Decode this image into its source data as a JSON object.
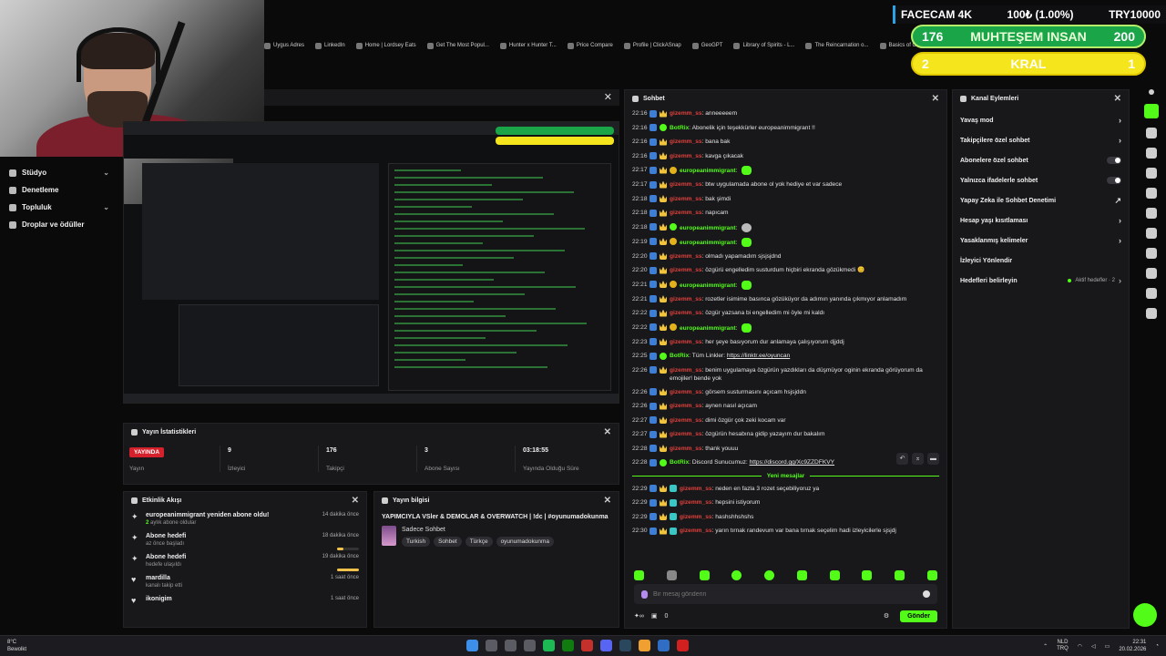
{
  "bookmarks": [
    "Uygus Adres",
    "LinkedIn",
    "Home | Lordsey Eats",
    "Get The Most Popul...",
    "Hunter x Hunter T...",
    "Price Compare",
    "Profile | ClickASnap",
    "GeoGPT",
    "Library of Spirits - L...",
    "The Reincarnation o...",
    "Basics of Online M..."
  ],
  "overlay": {
    "title": "FACECAM 4K",
    "progress": "100₺ (1.00%)",
    "goal_currency": "TRY10000",
    "goal1_left": "176",
    "goal1_label": "MUHTEŞEM INSAN",
    "goal1_right": "200",
    "goal2_left": "2",
    "goal2_label": "KRAL",
    "goal2_right": "1"
  },
  "sidebar": {
    "items": [
      {
        "label": "Stüdyo",
        "icon": "studio-icon",
        "expandable": true
      },
      {
        "label": "Denetleme",
        "icon": "moderation-icon",
        "expandable": false
      },
      {
        "label": "Topluluk",
        "icon": "community-icon",
        "expandable": true
      },
      {
        "label": "Droplar ve ödüller",
        "icon": "gift-icon",
        "expandable": false
      }
    ]
  },
  "stats": {
    "title": "Yayın İstatistikleri",
    "live_badge": "YAYINDA",
    "items": [
      {
        "value": "",
        "label": "Yayın"
      },
      {
        "value": "9",
        "label": "İzleyici"
      },
      {
        "value": "176",
        "label": "Takipçi"
      },
      {
        "value": "3",
        "label": "Abone Sayısı"
      },
      {
        "value": "03:18:55",
        "label": "Yayında Olduğu Süre"
      }
    ]
  },
  "activity": {
    "title": "Etkinlik Akışı",
    "items": [
      {
        "icon": "sparkle-icon",
        "title": "europeanimmigrant yeniden abone oldu!",
        "sub_strong": "2",
        "sub": "aylık abone oldular",
        "time": "14 dakika önce",
        "progress": null
      },
      {
        "icon": "sparkle-icon",
        "title": "Abone hedefi",
        "sub_strong": "",
        "sub": "az önce başladı",
        "time": "18 dakika önce",
        "progress": 0.3
      },
      {
        "icon": "sparkle-icon",
        "title": "Abone hedefi",
        "sub_strong": "",
        "sub": "hedefe ulaşıldı",
        "time": "19 dakika önce",
        "progress": 1.0
      },
      {
        "icon": "heart-icon",
        "title": "mardilla",
        "sub_strong": "",
        "sub": "kanalı takip etti",
        "time": "1 saat önce",
        "progress": null
      },
      {
        "icon": "heart-icon",
        "title": "ikonigim",
        "sub_strong": "",
        "sub": "",
        "time": "1 saat önce",
        "progress": null
      }
    ]
  },
  "stream_info": {
    "title": "Yayın bilgisi",
    "stream_title": "YAPIMCIYLA VSler & DEMOLAR & OVERWATCH | !dc | #oyunumadokunma",
    "category": "Sadece Sohbet",
    "tags": [
      "Turkish",
      "Sohbet",
      "Türkçe",
      "oyunumadokunma"
    ]
  },
  "chat": {
    "title": "Sohbet",
    "new_messages_label": "Yeni mesajlar",
    "input_placeholder": "Bir mesaj gönderin",
    "send_label": "Gönder",
    "footer_count": "0",
    "messages": [
      {
        "time": "22:16",
        "badges": [
          "blue",
          "crown"
        ],
        "user": "gizemm_ss",
        "uc": "u-red",
        "text": "anneeeeem"
      },
      {
        "time": "22:16",
        "badges": [
          "blue",
          "green"
        ],
        "user": "BotRix",
        "uc": "u-bot",
        "text": "Abonelik için teşekkürler europeanimmigrant !!"
      },
      {
        "time": "22:16",
        "badges": [
          "blue",
          "crown"
        ],
        "user": "gizemm_ss",
        "uc": "u-red",
        "text": "bana bak"
      },
      {
        "time": "22:16",
        "badges": [
          "blue",
          "crown"
        ],
        "user": "gizemm_ss",
        "uc": "u-red",
        "text": "kavga çıkacak"
      },
      {
        "time": "22:17",
        "badges": [
          "blue",
          "crown",
          "gold"
        ],
        "user": "europeanimmigrant",
        "uc": "u-green",
        "text": "",
        "emote": "green"
      },
      {
        "time": "22:17",
        "badges": [
          "blue",
          "crown"
        ],
        "user": "gizemm_ss",
        "uc": "u-red",
        "text": "btw uygulamada abone ol yok hediye et var sadece"
      },
      {
        "time": "22:18",
        "badges": [
          "blue",
          "crown"
        ],
        "user": "gizemm_ss",
        "uc": "u-red",
        "text": "bak şimdi"
      },
      {
        "time": "22:18",
        "badges": [
          "blue",
          "crown"
        ],
        "user": "gizemm_ss",
        "uc": "u-red",
        "text": "napıcam"
      },
      {
        "time": "22:18",
        "badges": [
          "blue",
          "crown",
          "green"
        ],
        "user": "europeanimmigrant",
        "uc": "u-green",
        "text": "",
        "emote": "gray"
      },
      {
        "time": "22:19",
        "badges": [
          "blue",
          "crown",
          "gold"
        ],
        "user": "europeanimmigrant",
        "uc": "u-green",
        "text": "",
        "emote": "green"
      },
      {
        "time": "22:20",
        "badges": [
          "blue",
          "crown"
        ],
        "user": "gizemm_ss",
        "uc": "u-red",
        "text": "olmadı yapamadım sjsjsjdnd"
      },
      {
        "time": "22:20",
        "badges": [
          "blue",
          "crown"
        ],
        "user": "gizemm_ss",
        "uc": "u-red",
        "text": "özgürü engelledim susturdum hiçbiri ekranda gözükmedi 😊"
      },
      {
        "time": "22:21",
        "badges": [
          "blue",
          "crown",
          "gold"
        ],
        "user": "europeanimmigrant",
        "uc": "u-green",
        "text": "",
        "emote": "green"
      },
      {
        "time": "22:21",
        "badges": [
          "blue",
          "crown"
        ],
        "user": "gizemm_ss",
        "uc": "u-red",
        "text": "rozetler isimime basınca gözüküyor da adımın yanında çıkmıyor anlamadım"
      },
      {
        "time": "22:22",
        "badges": [
          "blue",
          "crown"
        ],
        "user": "gizemm_ss",
        "uc": "u-red",
        "text": "özgür yazsana bi engelledim mi öyle mi kaldı"
      },
      {
        "time": "22:22",
        "badges": [
          "blue",
          "crown",
          "gold"
        ],
        "user": "europeanimmigrant",
        "uc": "u-green",
        "text": "",
        "emote": "green"
      },
      {
        "time": "22:23",
        "badges": [
          "blue",
          "crown"
        ],
        "user": "gizemm_ss",
        "uc": "u-red",
        "text": "her şeye basıyorum dur anlamaya çalışıyorum djjddj"
      },
      {
        "time": "22:25",
        "badges": [
          "blue",
          "green"
        ],
        "user": "BotRix",
        "uc": "u-bot",
        "text": "Tüm Linkler: ",
        "link": "https://linktr.ee/oyuncan"
      },
      {
        "time": "22:26",
        "badges": [
          "blue",
          "crown"
        ],
        "user": "gizemm_ss",
        "uc": "u-red",
        "text": "benim uygulamaya özgürün yazdıkları da düşmüyor oginin ekranda görüyorum da emojiler! bende yok"
      },
      {
        "time": "22:26",
        "badges": [
          "blue",
          "crown"
        ],
        "user": "gizemm_ss",
        "uc": "u-red",
        "text": "görsem susturmasını açıcam hsjsjddn"
      },
      {
        "time": "22:26",
        "badges": [
          "blue",
          "crown"
        ],
        "user": "gizemm_ss",
        "uc": "u-red",
        "text": "aynen nasıl açıcam"
      },
      {
        "time": "22:27",
        "badges": [
          "blue",
          "crown"
        ],
        "user": "gizemm_ss",
        "uc": "u-red",
        "text": "dimi özgür çok zeki kocam var"
      },
      {
        "time": "22:27",
        "badges": [
          "blue",
          "crown"
        ],
        "user": "gizemm_ss",
        "uc": "u-red",
        "text": "özgürün hesabına gidip yazayım dur bakalım"
      },
      {
        "time": "22:28",
        "badges": [
          "blue",
          "crown"
        ],
        "user": "gizemm_ss",
        "uc": "u-red",
        "text": "thank youuu"
      },
      {
        "time": "22:28",
        "badges": [
          "blue",
          "green"
        ],
        "user": "BotRix",
        "uc": "u-bot",
        "text": "Discord Sunucumuz: ",
        "link": "https://discord.gg/Xc9ZZDFKVY"
      }
    ],
    "new_messages": [
      {
        "time": "22:29",
        "badges": [
          "blue",
          "crown",
          "teal"
        ],
        "user": "gizemm_ss",
        "uc": "u-red",
        "text": "neden en fazla 3 rozet seçebiliyoruz ya"
      },
      {
        "time": "22:29",
        "badges": [
          "blue",
          "crown",
          "teal"
        ],
        "user": "gizemm_ss",
        "uc": "u-red",
        "text": "hepsini istiyorum"
      },
      {
        "time": "22:29",
        "badges": [
          "blue",
          "crown",
          "teal"
        ],
        "user": "gizemm_ss",
        "uc": "u-red",
        "text": "hashshhshshs"
      },
      {
        "time": "22:30",
        "badges": [
          "blue",
          "crown",
          "teal"
        ],
        "user": "gizemm_ss",
        "uc": "u-red",
        "text": "yarın tırnak randevum var bana tırnak seçelim hadi izleyicilerle sjsjdj"
      }
    ]
  },
  "actions": {
    "title": "Kanal Eylemleri",
    "rows": [
      {
        "label": "Yavaş mod",
        "control": "chevron"
      },
      {
        "label": "Takipçilere özel sohbet",
        "control": "chevron"
      },
      {
        "label": "Abonelere özel sohbet",
        "control": "toggle"
      },
      {
        "label": "Yalnızca ifadelerle sohbet",
        "control": "toggle"
      },
      {
        "label": "Yapay Zeka ile Sohbet Denetimi",
        "control": "external"
      },
      {
        "label": "Hesap yaşı kısıtlaması",
        "control": "chevron"
      },
      {
        "label": "Yasaklanmış kelimeler",
        "control": "chevron"
      },
      {
        "label": "İzleyici Yönlendir",
        "control": "none"
      },
      {
        "label": "Hedefleri belirleyin",
        "control": "goal"
      }
    ],
    "goal_status": "Aktif hedefler · 2"
  },
  "taskbar": {
    "weather_temp": "8°C",
    "weather_desc": "Bewolkt",
    "lang": "NLD",
    "lang2": "TRQ",
    "time": "22:31",
    "date": "20.02.2026"
  }
}
